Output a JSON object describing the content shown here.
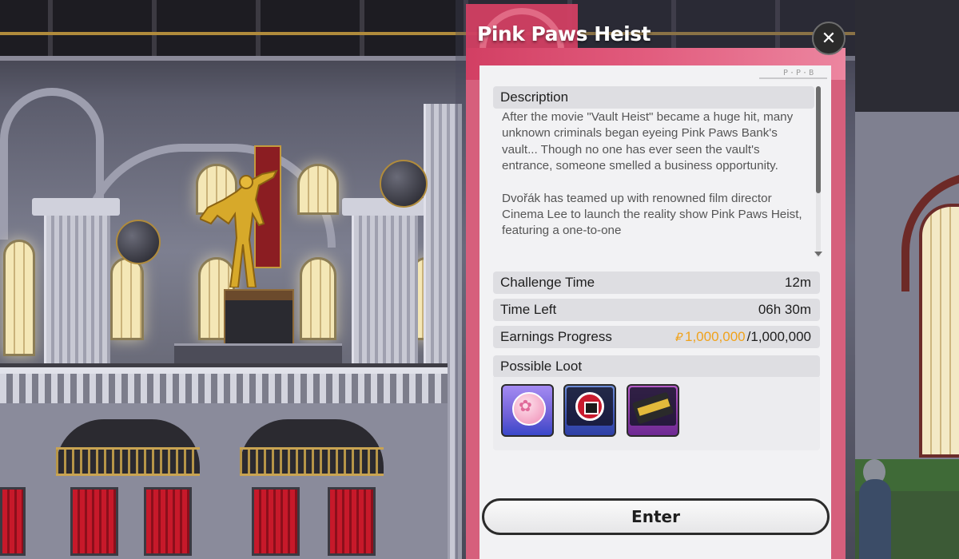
{
  "modal": {
    "title": "Pink Paws Heist",
    "close_icon": "close-icon",
    "watermark": "P·P·B"
  },
  "description": {
    "heading": "Description",
    "paragraphs": [
      "After the movie \"Vault Heist\" became a huge hit, many unknown criminals began eyeing Pink Paws Bank's vault... Though no one has ever seen the vault's entrance, someone smelled a business opportunity.",
      "Dvořák has teamed up with renowned film director Cinema Lee to launch the reality show Pink Paws Heist, featuring a one-to-one"
    ]
  },
  "stats": {
    "challenge_time": {
      "label": "Challenge Time",
      "value": "12m"
    },
    "time_left": {
      "label": "Time Left",
      "value": "06h 30m"
    },
    "earnings_progress": {
      "label": "Earnings Progress",
      "currency_icon": "₽",
      "current": "1,000,000",
      "total": "/1,000,000"
    }
  },
  "loot": {
    "heading": "Possible Loot",
    "items": [
      {
        "icon": "pink-paw-coin-icon"
      },
      {
        "icon": "ppb-bank-emblem-icon"
      },
      {
        "icon": "gold-ticket-icon"
      }
    ]
  },
  "actions": {
    "enter_label": "Enter"
  },
  "colors": {
    "accent_pink": "#d23f63",
    "earnings_highlight": "#f0a21b",
    "panel_bg": "#f2f2f4"
  }
}
